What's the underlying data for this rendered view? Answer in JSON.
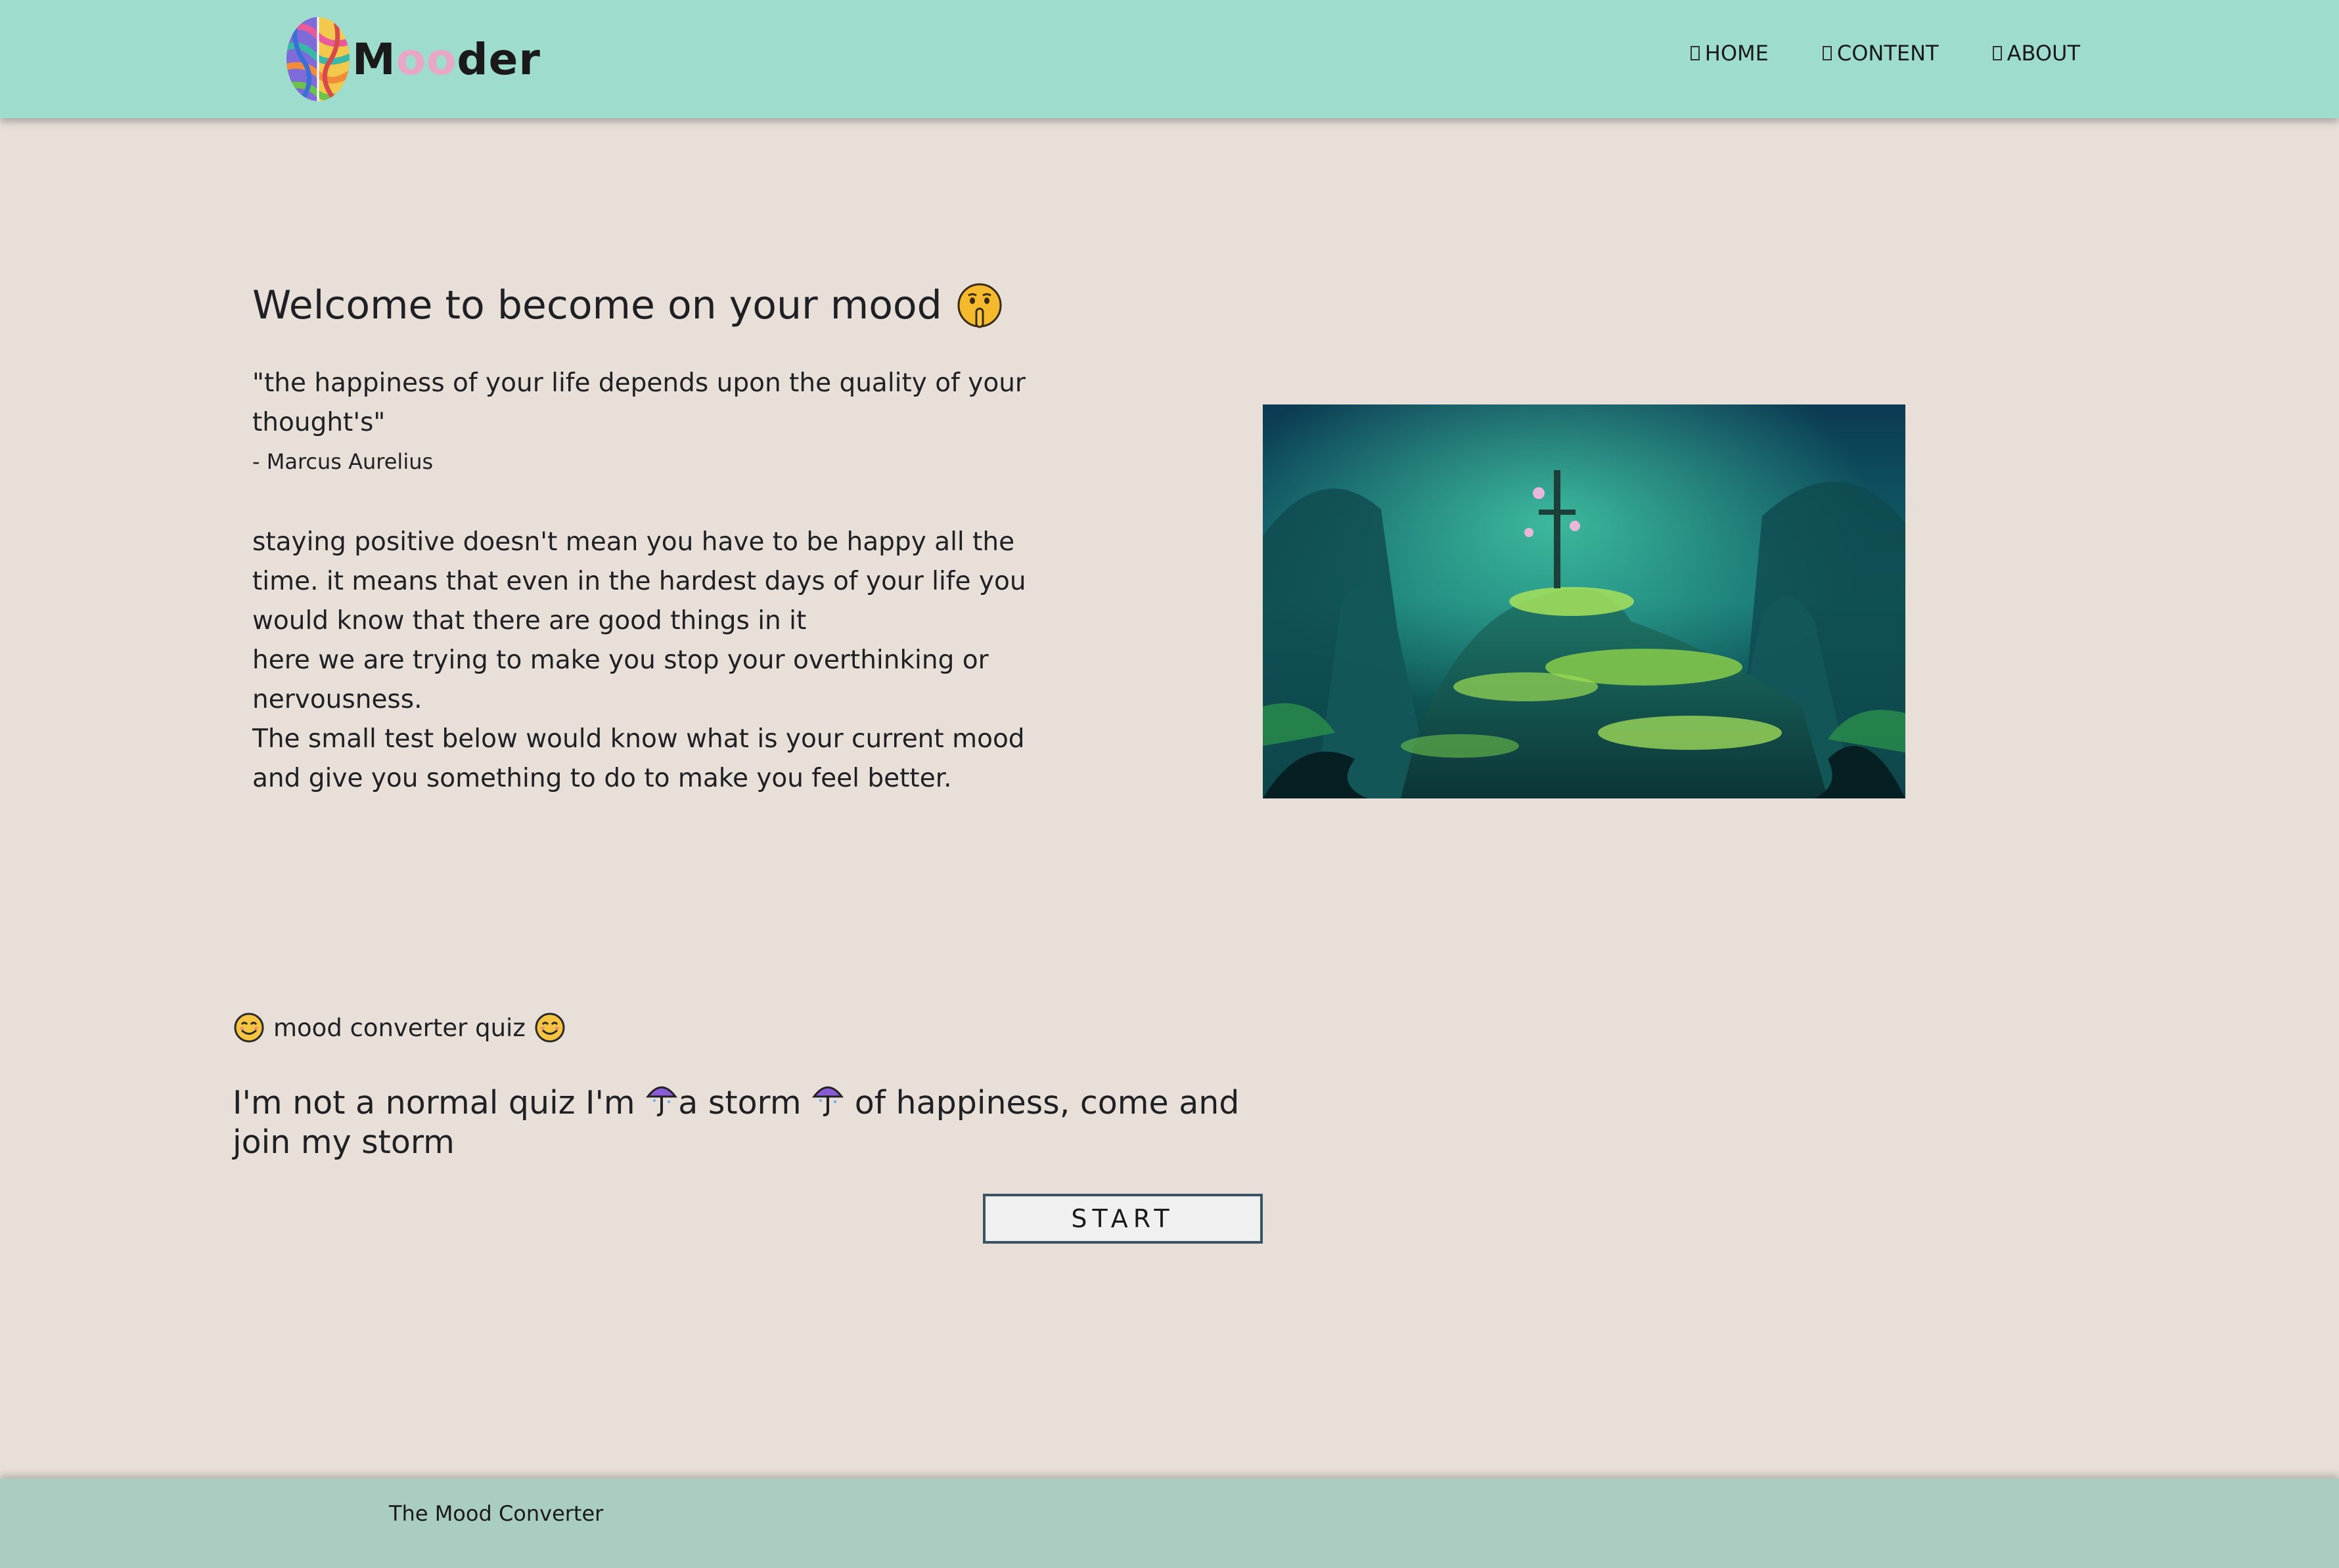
{
  "header": {
    "logo_prefix": "M",
    "logo_pink": "oo",
    "logo_suffix": "der",
    "nav": [
      {
        "label": "HOME"
      },
      {
        "label": "CONTENT"
      },
      {
        "label": "ABOUT"
      }
    ]
  },
  "hero": {
    "title": "Welcome to become on your mood",
    "quote": "\"the happiness of your life depends upon the quality of your thought's\"",
    "author": "- Marcus Aurelius",
    "paragraphs": [
      "staying positive doesn't mean you have to be happy all the time. it means that even in the hardest days of your life you would know that there are good things in it",
      "here we are trying to make you stop your overthinking or nervousness.",
      "The small test below would know what is your current mood and give you something to do to make you feel better."
    ]
  },
  "quiz": {
    "label": "mood converter quiz",
    "tagline_part1": "I'm not a normal quiz I'm ",
    "tagline_part2": "a storm ",
    "tagline_part3": " of happiness, come and join my storm",
    "start_label": "START"
  },
  "footer": {
    "text": "The Mood Converter"
  },
  "colors": {
    "header_bg": "#9edccd",
    "page_bg": "#e8dfd9",
    "footer_bg": "#a9cdc0",
    "logo_accent": "#e9a7c8",
    "button_border": "#3b5363"
  }
}
